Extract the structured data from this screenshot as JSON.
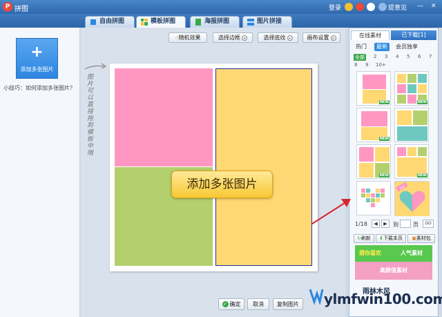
{
  "app": {
    "title": "拼图",
    "login": "登录",
    "feedback": "提意见"
  },
  "tabs": [
    {
      "label": "自由拼图"
    },
    {
      "label": "模板拼图",
      "active": true
    },
    {
      "label": "海报拼图"
    },
    {
      "label": "图片拼接"
    }
  ],
  "left": {
    "add_label": "添加多张图片",
    "tip": "小技巧：如何添加多张图片？"
  },
  "toolbar": {
    "random": "随机效果",
    "border": "选择边框",
    "texture": "选择底纹",
    "canvas": "画布设置"
  },
  "canvas_hint": "图片可以直接拖到模板中哦",
  "add_overlay": "添加多张图片",
  "bottom": {
    "ok": "确定",
    "cancel": "取消",
    "copy": "复制图片"
  },
  "right": {
    "tab_online": "在线素材",
    "tab_downloaded": "已下载[1]",
    "cats": [
      "热门",
      "最新",
      "会员独享"
    ],
    "nums": [
      "全部",
      "2",
      "3",
      "4",
      "5",
      "6",
      "7",
      "8",
      "9",
      "10+"
    ],
    "new_badge": "NEW",
    "heart_badge": "会员",
    "page": "1/18",
    "goto": "到",
    "page_unit": "页",
    "go": "GO",
    "refresh": "刷新",
    "download_page": "下载本页",
    "pack": "素材包",
    "promo": [
      "猜你喜欢",
      "人气素材",
      "高颜值素材"
    ]
  },
  "watermark": {
    "text": "ylmfwin100.com",
    "sub": "雨林木风"
  },
  "colors": {
    "pink": "#ff97c2",
    "green": "#b4d06e",
    "yellow": "#ffd873",
    "blue_border": "#1c2fa0",
    "accent_blue": "#2d86e0",
    "new_green": "#3aa84a",
    "arrow_red": "#d8242e"
  }
}
